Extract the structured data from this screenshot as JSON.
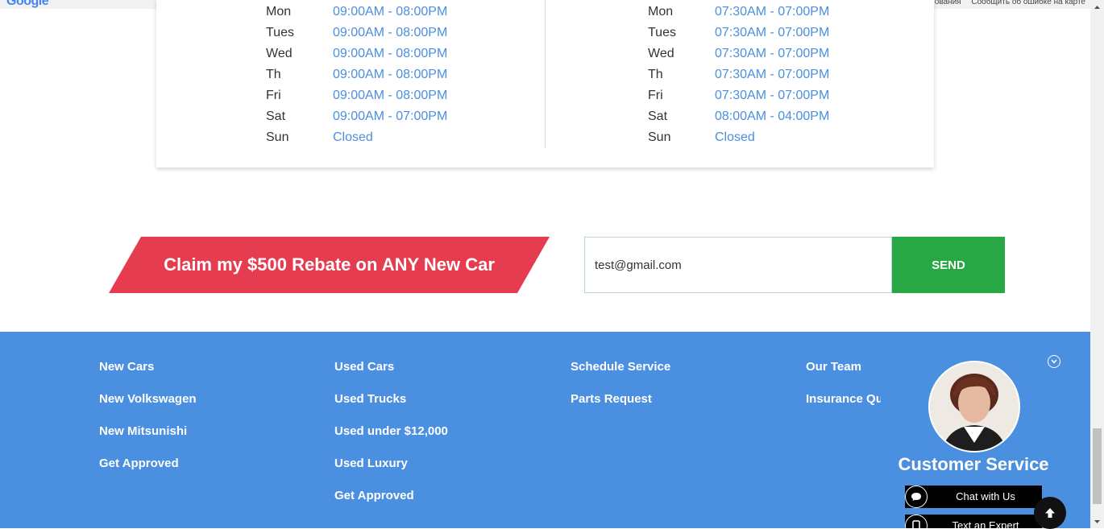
{
  "map": {
    "logo": "Google",
    "links": [
      "ования",
      "Сообщить об ошибке на карте"
    ]
  },
  "hours": {
    "sales": [
      {
        "day": "Mon",
        "time": "09:00AM - 08:00PM"
      },
      {
        "day": "Tues",
        "time": "09:00AM - 08:00PM"
      },
      {
        "day": "Wed",
        "time": "09:00AM - 08:00PM"
      },
      {
        "day": "Th",
        "time": "09:00AM - 08:00PM"
      },
      {
        "day": "Fri",
        "time": "09:00AM - 08:00PM"
      },
      {
        "day": "Sat",
        "time": "09:00AM - 07:00PM"
      },
      {
        "day": "Sun",
        "time": "Closed"
      }
    ],
    "service": [
      {
        "day": "Mon",
        "time": "07:30AM - 07:00PM"
      },
      {
        "day": "Tues",
        "time": "07:30AM - 07:00PM"
      },
      {
        "day": "Wed",
        "time": "07:30AM - 07:00PM"
      },
      {
        "day": "Th",
        "time": "07:30AM - 07:00PM"
      },
      {
        "day": "Fri",
        "time": "07:30AM - 07:00PM"
      },
      {
        "day": "Sat",
        "time": "08:00AM - 04:00PM"
      },
      {
        "day": "Sun",
        "time": "Closed"
      }
    ]
  },
  "rebate": {
    "label": "Claim my $500 Rebate on ANY New Car",
    "email_value": "test@gmail.com",
    "send_label": "SEND",
    "banner_color": "#e63c50",
    "send_color": "#28a745"
  },
  "footer": {
    "background": "#4a8fe0",
    "columns": [
      [
        "New Cars",
        "New Volkswagen",
        "New Mitsunishi",
        "Get Approved"
      ],
      [
        "Used Cars",
        "Used Trucks",
        "Used under $12,000",
        "Used Luxury",
        "Get Approved"
      ],
      [
        "Schedule Service",
        "Parts Request"
      ],
      [
        "Our Team",
        "Insurance Qu"
      ]
    ]
  },
  "customer_service": {
    "title": "Customer Service",
    "chat_label": "Chat with Us",
    "text_label": "Text an Expert",
    "close_icon": "chevron-down-circle-icon",
    "chat_icon": "speech-bubble-icon",
    "text_icon": "phone-icon"
  },
  "scroll_top": {
    "icon": "arrow-up-icon"
  }
}
